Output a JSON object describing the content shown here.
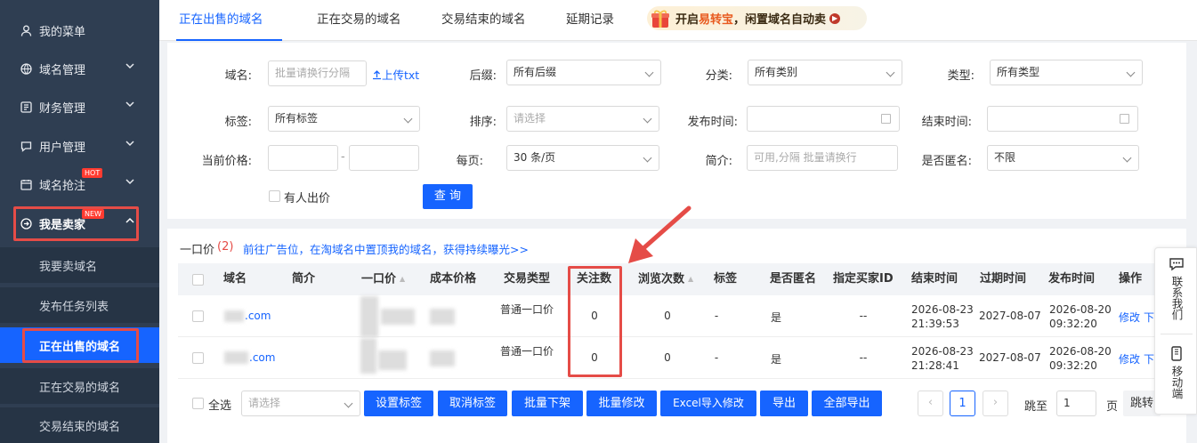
{
  "sidebar": {
    "items": [
      {
        "label": "我的菜单",
        "icon": "user-icon"
      },
      {
        "label": "域名管理",
        "icon": "globe-icon"
      },
      {
        "label": "财务管理",
        "icon": "finance-icon"
      },
      {
        "label": "用户管理",
        "icon": "chat-icon"
      },
      {
        "label": "域名抢注",
        "icon": "calendar-icon",
        "badge": "HOT"
      },
      {
        "label": "我是卖家",
        "icon": "seller-icon",
        "badge": "NEW"
      }
    ],
    "sub_items": [
      {
        "label": "我要卖域名"
      },
      {
        "label": "发布任务列表"
      },
      {
        "label": "正在出售的域名"
      },
      {
        "label": "正在交易的域名"
      },
      {
        "label": "交易结束的域名"
      }
    ]
  },
  "tabs": [
    {
      "label": "正在出售的域名"
    },
    {
      "label": "正在交易的域名"
    },
    {
      "label": "交易结束的域名"
    },
    {
      "label": "延期记录"
    }
  ],
  "promo": {
    "pre": "开启",
    "brand": "易转宝",
    "post": "，闲置域名自动卖"
  },
  "filter": {
    "domain_label": "域名:",
    "domain_placeholder": "批量请换行分隔",
    "upload_label": "上传txt",
    "suffix_label": "后缀:",
    "suffix_value": "所有后缀",
    "category_label": "分类:",
    "category_value": "所有类别",
    "type_label": "类型:",
    "type_value": "所有类型",
    "tag_label": "标签:",
    "tag_value": "所有标签",
    "sort_label": "排序:",
    "sort_placeholder": "请选择",
    "publish_time_label": "发布时间:",
    "end_time_label": "结束时间:",
    "price_label": "当前价格:",
    "price_sep": "-",
    "per_page_label": "每页:",
    "per_page_value": "30 条/页",
    "intro_label": "简介:",
    "intro_placeholder": "可用,分隔 批量请换行",
    "anonymous_label": "是否匿名:",
    "anonymous_value": "不限",
    "bid_label": "有人出价",
    "query_button": "查 询"
  },
  "results": {
    "fixed_price_label": "一口价",
    "fixed_price_count": "(2)",
    "promo_link": "前往广告位，在淘域名中置顶我的域名，获得持续曝光>>"
  },
  "table": {
    "headers": [
      "域名",
      "简介",
      "一口价",
      "成本价格",
      "交易类型",
      "关注数",
      "浏览次数",
      "标签",
      "是否匿名",
      "指定买家ID",
      "结束时间",
      "过期时间",
      "发布时间",
      "操作"
    ],
    "rows": [
      {
        "domain": ".com",
        "trade_type": "普通一口价",
        "follows": "0",
        "views": "0",
        "tag": "-",
        "anonymous": "是",
        "buyer_id": "--",
        "end_date": "2026-08-23",
        "end_time": "21:39:53",
        "expire": "2027-08-07",
        "pub_date": "2026-08-20",
        "pub_time": "09:32:20",
        "edit": "修改",
        "off": "下"
      },
      {
        "domain": ".com",
        "trade_type": "普通一口价",
        "follows": "0",
        "views": "0",
        "tag": "-",
        "anonymous": "是",
        "buyer_id": "--",
        "end_date": "2026-08-23",
        "end_time": "21:28:41",
        "expire": "2027-08-07",
        "pub_date": "2026-08-20",
        "pub_time": "09:32:20",
        "edit": "修改",
        "off": "下"
      }
    ]
  },
  "bottom": {
    "select_all": "全选",
    "select_placeholder": "请选择",
    "buttons": [
      "设置标签",
      "取消标签",
      "批量下架",
      "批量修改",
      "Excel导入修改",
      "导出",
      "全部导出"
    ],
    "current_page": "1",
    "jump_label": "跳至",
    "jump_value": "1",
    "page_label": "页",
    "jump_button": "跳转"
  },
  "float": {
    "contact": "联系我们",
    "mobile": "移动端"
  },
  "colors": {
    "primary": "#1664ff",
    "sidebar": "#2f3e52",
    "highlight": "#e54c47"
  }
}
